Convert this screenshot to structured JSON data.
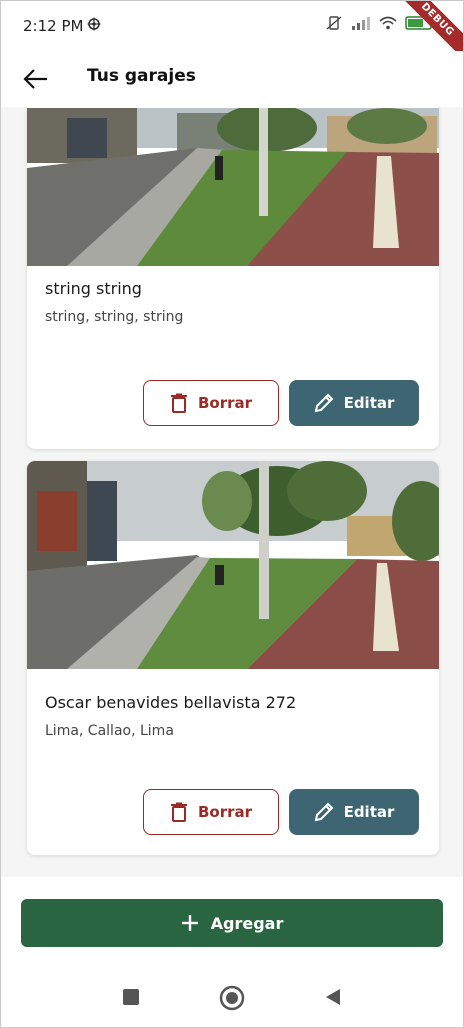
{
  "status_bar": {
    "time": "2:12 PM",
    "battery": "60",
    "debug_banner": "DEBUG"
  },
  "app_bar": {
    "title": "Tus garajes",
    "back_icon": "arrow-left-icon"
  },
  "garages": [
    {
      "title": "string string",
      "location": "string, string, string",
      "delete_label": "Borrar",
      "edit_label": "Editar"
    },
    {
      "title": "Oscar benavides bellavista 272",
      "location": "Lima, Callao, Lima",
      "delete_label": "Borrar",
      "edit_label": "Editar"
    }
  ],
  "footer": {
    "add_label": "Agregar",
    "add_icon": "plus-icon"
  },
  "colors": {
    "delete": "#9b2a25",
    "edit": "#3e6572",
    "add": "#2a6541"
  }
}
